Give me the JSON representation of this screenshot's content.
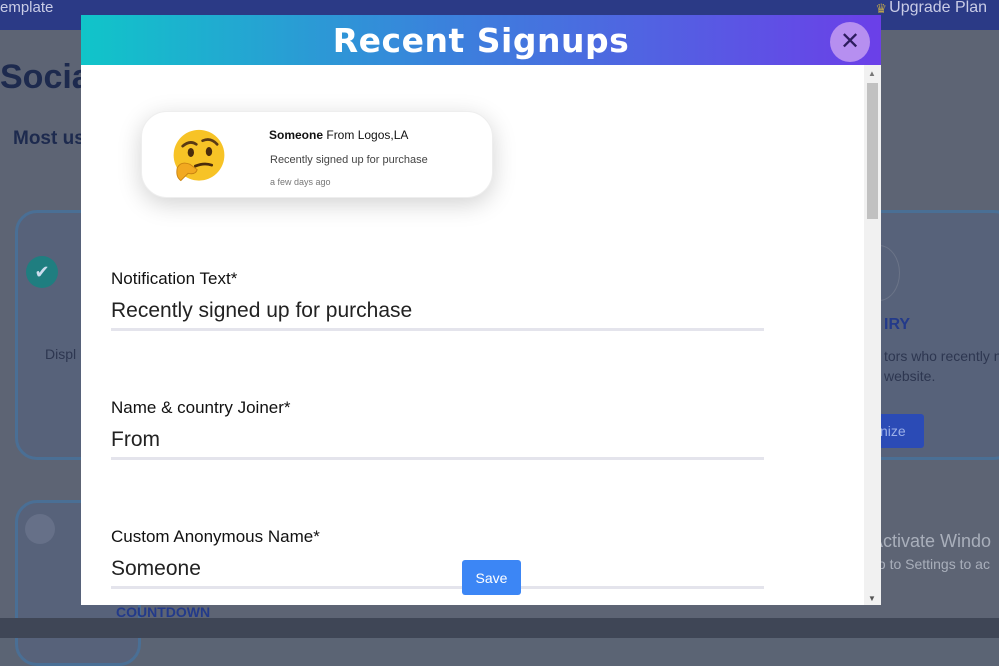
{
  "background": {
    "template_text": "emplate",
    "upgrade_label": "Upgrade Plan",
    "page_title": "Socia",
    "subtitle": "Most us",
    "card_text": "Displ",
    "right_card_title": "IRY",
    "right_card_desc": "tors who recently n website.",
    "right_card_button": "nize",
    "countdown_label": "COUNTDOWN",
    "activate_line1": "Activate Windo",
    "activate_line2": "Go to Settings to ac"
  },
  "modal": {
    "title": "Recent Signups",
    "close_icon": "close-icon",
    "preview": {
      "name": "Someone",
      "location": "From Logos,LA",
      "message": "Recently signed up for purchase",
      "time": "a few days ago",
      "emoji_icon": "thinking-face-icon"
    },
    "fields": {
      "notification_text": {
        "label": "Notification Text*",
        "value": "Recently signed up for purchase"
      },
      "name_country_joiner": {
        "label": "Name & country Joiner*",
        "value": "From"
      },
      "custom_anonymous_name": {
        "label": "Custom Anonymous Name*",
        "value": "Someone"
      }
    },
    "save_label": "Save"
  },
  "colors": {
    "header_gradient_start": "#10c5c9",
    "header_gradient_end": "#6b3fe8",
    "save_button": "#3c86f5",
    "close_button": "#b68ff0"
  }
}
